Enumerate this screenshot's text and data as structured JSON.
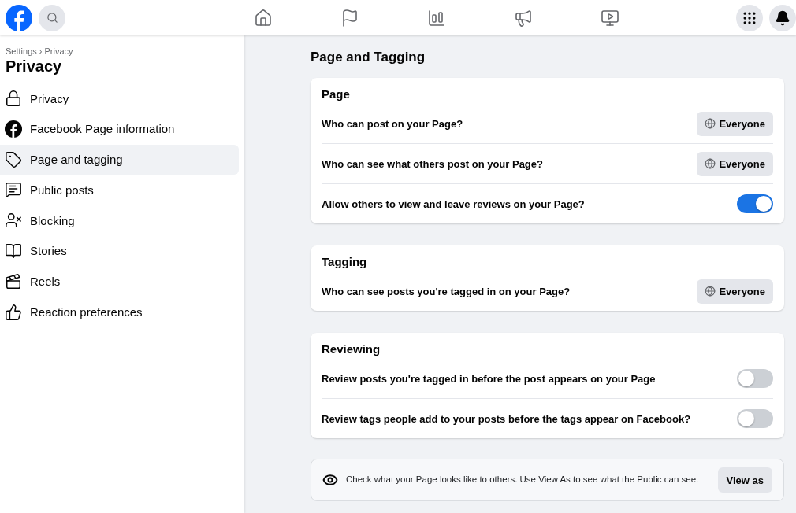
{
  "breadcrumb": "Settings › Privacy",
  "sidebar": {
    "title": "Privacy",
    "items": [
      {
        "label": "Privacy",
        "selected": false
      },
      {
        "label": "Facebook Page information",
        "selected": false
      },
      {
        "label": "Page and tagging",
        "selected": true
      },
      {
        "label": "Public posts",
        "selected": false
      },
      {
        "label": "Blocking",
        "selected": false
      },
      {
        "label": "Stories",
        "selected": false
      },
      {
        "label": "Reels",
        "selected": false
      },
      {
        "label": "Reaction preferences",
        "selected": false
      }
    ]
  },
  "heading": "Page and Tagging",
  "sections": [
    {
      "title": "Page",
      "rows": [
        {
          "kind": "select",
          "label": "Who can post on your Page?",
          "value": "Everyone"
        },
        {
          "kind": "select",
          "label": "Who can see what others post on your Page?",
          "value": "Everyone"
        },
        {
          "kind": "toggle",
          "label": "Allow others to view and leave reviews on your Page?",
          "on": true
        }
      ]
    },
    {
      "title": "Tagging",
      "rows": [
        {
          "kind": "select",
          "label": "Who can see posts you're tagged in on your Page?",
          "value": "Everyone"
        }
      ]
    },
    {
      "title": "Reviewing",
      "rows": [
        {
          "kind": "toggle",
          "label": "Review posts you're tagged in before the post appears on your Page",
          "on": false
        },
        {
          "kind": "toggle",
          "label": "Review tags people add to your posts before the tags appear on Facebook?",
          "on": false
        }
      ]
    }
  ],
  "view_as": {
    "text": "Check what your Page looks like to others. Use View As to see what the Public can see.",
    "button": "View as"
  }
}
